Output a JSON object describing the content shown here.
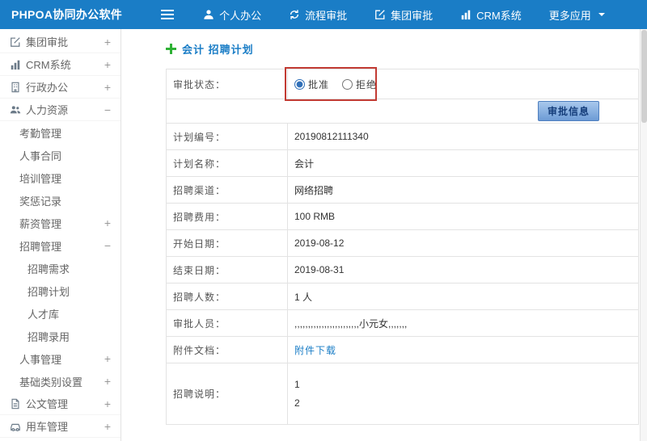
{
  "topbar": {
    "app_title": "PHPOA协同办公软件",
    "nav": [
      {
        "label": "个人办公",
        "icon": "person-icon"
      },
      {
        "label": "流程审批",
        "icon": "workflow-icon"
      },
      {
        "label": "集团审批",
        "icon": "edit-icon"
      },
      {
        "label": "CRM系统",
        "icon": "chart-icon"
      },
      {
        "label": "更多应用",
        "icon": "caret-down-icon"
      }
    ]
  },
  "sidebar": {
    "items": [
      {
        "label": "集团审批",
        "expand": "+",
        "icon": "edit-icon"
      },
      {
        "label": "CRM系统",
        "expand": "+",
        "icon": "chart-icon"
      },
      {
        "label": "行政办公",
        "expand": "+",
        "icon": "building-icon"
      },
      {
        "label": "人力资源",
        "expand": "−",
        "icon": "users-icon"
      },
      {
        "label": "考勤管理",
        "expand": ""
      },
      {
        "label": "人事合同",
        "expand": ""
      },
      {
        "label": "培训管理",
        "expand": ""
      },
      {
        "label": "奖惩记录",
        "expand": ""
      },
      {
        "label": "薪资管理",
        "expand": "+"
      },
      {
        "label": "招聘管理",
        "expand": "−"
      },
      {
        "label": "招聘需求",
        "expand": ""
      },
      {
        "label": "招聘计划",
        "expand": ""
      },
      {
        "label": "人才库",
        "expand": ""
      },
      {
        "label": "招聘录用",
        "expand": ""
      },
      {
        "label": "人事管理",
        "expand": "+"
      },
      {
        "label": "基础类别设置",
        "expand": "+"
      },
      {
        "label": "公文管理",
        "expand": "+",
        "icon": "doc-icon"
      },
      {
        "label": "用车管理",
        "expand": "+",
        "icon": "car-icon"
      }
    ]
  },
  "content": {
    "title": "会计 招聘计划",
    "form": {
      "status_label": "审批状态：",
      "radio_approve": "批准",
      "radio_reject": "拒绝",
      "approve_button": "审批信息",
      "fields": [
        {
          "label": "计划编号：",
          "value": "20190812111340"
        },
        {
          "label": "计划名称：",
          "value": "会计"
        },
        {
          "label": "招聘渠道：",
          "value": "网络招聘"
        },
        {
          "label": "招聘费用：",
          "value": "100 RMB"
        },
        {
          "label": "开始日期：",
          "value": "2019-08-12"
        },
        {
          "label": "结束日期：",
          "value": "2019-08-31"
        },
        {
          "label": "招聘人数：",
          "value": "1 人"
        },
        {
          "label": "审批人员：",
          "value": ",,,,,,,,,,,,,,,,,,,,,,,,小元女,,,,,,,"
        }
      ],
      "attachment": {
        "label": "附件文档：",
        "link": "附件下载"
      },
      "remark": {
        "label": "招聘说明：",
        "line1": "1",
        "line2": "2"
      }
    }
  },
  "colors": {
    "topbar_blue": "#1a7dc6",
    "link_blue": "#1a7dc6",
    "plus_green": "#2eb135",
    "annotation_red": "#c23b33",
    "button_blue": "#6d9bd6"
  }
}
